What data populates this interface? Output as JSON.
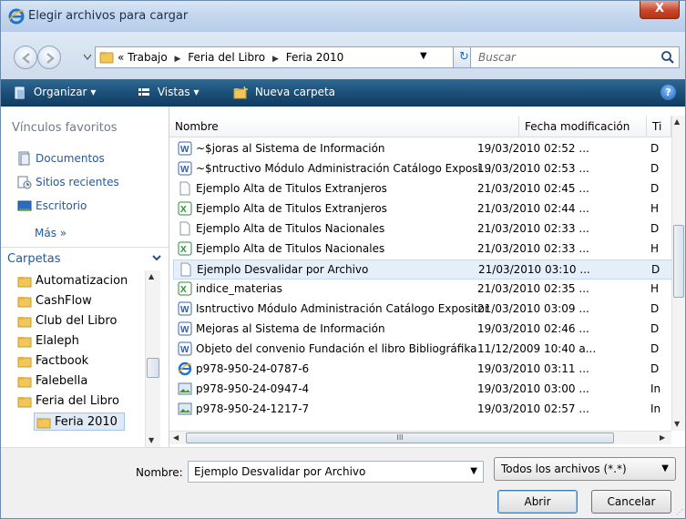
{
  "window": {
    "title": "Elegir archivos para cargar",
    "close_label": "X"
  },
  "address": {
    "prefix": "«",
    "path": [
      "Trabajo",
      "Feria del Libro",
      "Feria 2010"
    ],
    "search_placeholder": "Buscar"
  },
  "toolbar": {
    "organize": "Organizar",
    "views": "Vistas",
    "new_folder": "Nueva carpeta",
    "help": "?"
  },
  "navpane": {
    "favorites_header": "Vínculos favoritos",
    "favorites": [
      {
        "label": "Documentos",
        "icon": "documents-icon"
      },
      {
        "label": "Sitios recientes",
        "icon": "recent-sites-icon"
      },
      {
        "label": "Escritorio",
        "icon": "desktop-icon"
      }
    ],
    "more": "Más »",
    "folders_header": "Carpetas",
    "folders": [
      "Automatizacion",
      "CashFlow",
      "Club del Libro",
      "Elaleph",
      "Factbook",
      "Falebella",
      "Feria del Libro",
      "Feria 2010"
    ]
  },
  "filelist": {
    "columns": {
      "name": "Nombre",
      "date": "Fecha modificación",
      "type": "Ti"
    },
    "rows": [
      {
        "name": "~$joras al Sistema de Información",
        "date": "19/03/2010 02:52 ...",
        "type": "D",
        "icon": "word-icon"
      },
      {
        "name": "~$ntructivo Módulo Administración Catálogo Exposi...",
        "date": "19/03/2010 02:53 ...",
        "type": "D",
        "icon": "word-icon"
      },
      {
        "name": "Ejemplo Alta de Titulos Extranjeros",
        "date": "21/03/2010 02:45 ...",
        "type": "D",
        "icon": "text-file-icon"
      },
      {
        "name": "Ejemplo Alta de Titulos Extranjeros",
        "date": "21/03/2010 02:44 ...",
        "type": "H",
        "icon": "excel-icon"
      },
      {
        "name": "Ejemplo Alta de Titulos Nacionales",
        "date": "21/03/2010 02:33 ...",
        "type": "D",
        "icon": "text-file-icon"
      },
      {
        "name": "Ejemplo Alta de Titulos Nacionales",
        "date": "21/03/2010 02:33 ...",
        "type": "H",
        "icon": "excel-icon"
      },
      {
        "name": "Ejemplo Desvalidar por Archivo",
        "date": "21/03/2010 03:10 ...",
        "type": "D",
        "icon": "text-file-icon",
        "selected": true
      },
      {
        "name": "indice_materias",
        "date": "21/03/2010 02:35 ...",
        "type": "H",
        "icon": "excel-icon"
      },
      {
        "name": "Isntructivo Módulo Administración Catálogo Expositor",
        "date": "21/03/2010 03:09 ...",
        "type": "D",
        "icon": "word-icon"
      },
      {
        "name": "Mejoras al Sistema de Información",
        "date": "19/03/2010 02:46 ...",
        "type": "D",
        "icon": "word-icon"
      },
      {
        "name": "Objeto del convenio Fundación el libro Bibliográfika",
        "date": "11/12/2009 10:40 a...",
        "type": "D",
        "icon": "word-icon"
      },
      {
        "name": "p978-950-24-0787-6",
        "date": "19/03/2010 03:11 ...",
        "type": "D",
        "icon": "ie-html-icon"
      },
      {
        "name": "p978-950-24-0947-4",
        "date": "19/03/2010 03:00 ...",
        "type": "In",
        "icon": "image-icon"
      },
      {
        "name": "p978-950-24-1217-7",
        "date": "19/03/2010 02:57 ...",
        "type": "In",
        "icon": "image-icon"
      }
    ],
    "hscroll_grip": "III"
  },
  "bottom": {
    "name_label": "Nombre:",
    "name_value": "Ejemplo Desvalidar por Archivo",
    "type_value": "Todos los archivos (*.*)",
    "open_label": "Abrir",
    "cancel_label": "Cancelar"
  }
}
